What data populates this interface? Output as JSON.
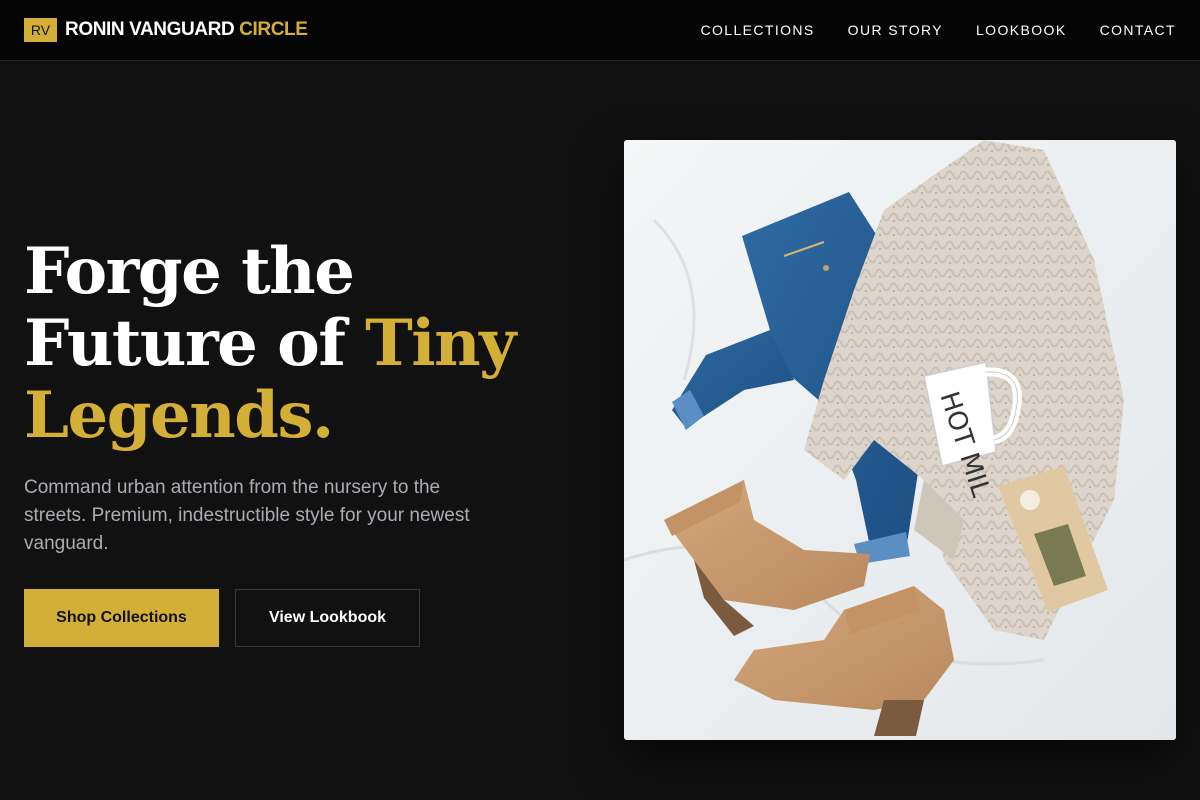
{
  "brand": {
    "logo_mark": "RV",
    "name_primary": "RONIN VANGUARD",
    "name_accent": "CIRCLE"
  },
  "nav": {
    "items": [
      "COLLECTIONS",
      "OUR STORY",
      "LOOKBOOK",
      "CONTACT"
    ]
  },
  "hero": {
    "headline_line1": "Forge the",
    "headline_line2_white": "Future of",
    "headline_line2_gold": "Tiny",
    "headline_line3_gold": "Legends.",
    "subtext": "Command urban attention from the nursery to the streets. Premium, indestructible style for your newest vanguard.",
    "primary_cta": "Shop Collections",
    "secondary_cta": "View Lookbook"
  },
  "image": {
    "description_icon": "flatlay-photo",
    "mug_text": "HOT MIL"
  },
  "colors": {
    "background": "#111111",
    "header": "#050505",
    "accent": "#d4af37",
    "muted_text": "#a9adb3"
  }
}
